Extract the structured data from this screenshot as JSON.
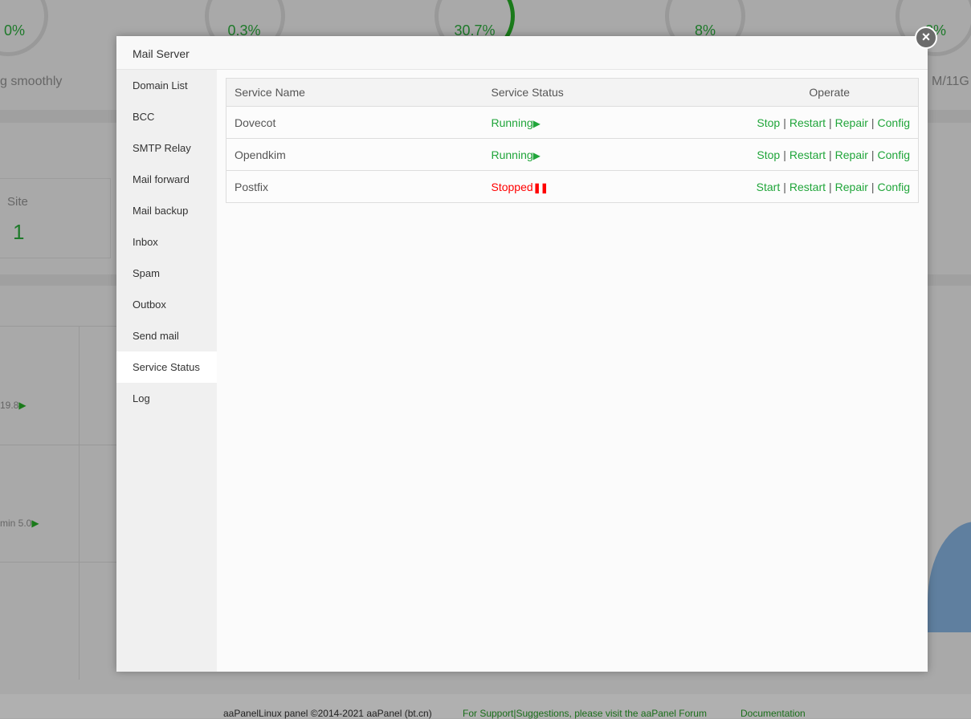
{
  "background": {
    "gauges": [
      {
        "value": "0%"
      },
      {
        "value": "0.3%"
      },
      {
        "value": "30.7%"
      },
      {
        "value": "8%"
      },
      {
        "value": "3%"
      }
    ],
    "gauge_sub_left": "g smoothly",
    "gauge_sub_right": "M/11G",
    "site_label": "Site",
    "site_value": "1",
    "app1": "19.8",
    "app2": "min 5.0"
  },
  "modal": {
    "title": "Mail Server",
    "close_icon": "close-icon",
    "sidebar": [
      {
        "label": "Domain List"
      },
      {
        "label": "BCC"
      },
      {
        "label": "SMTP Relay"
      },
      {
        "label": "Mail forward"
      },
      {
        "label": "Mail backup"
      },
      {
        "label": "Inbox"
      },
      {
        "label": "Spam"
      },
      {
        "label": "Outbox"
      },
      {
        "label": "Send mail"
      },
      {
        "label": "Service Status",
        "active": true
      },
      {
        "label": "Log"
      }
    ],
    "table": {
      "headers": [
        "Service Name",
        "Service Status",
        "Operate"
      ],
      "rows": [
        {
          "name": "Dovecot",
          "status": "Running",
          "status_icon": "play-icon",
          "status_color": "#20a53a",
          "ops": [
            "Stop",
            "Restart",
            "Repair",
            "Config"
          ]
        },
        {
          "name": "Opendkim",
          "status": "Running",
          "status_icon": "play-icon",
          "status_color": "#20a53a",
          "ops": [
            "Stop",
            "Restart",
            "Repair",
            "Config"
          ]
        },
        {
          "name": "Postfix",
          "status": "Stopped",
          "status_icon": "pause-icon",
          "status_color": "#ff0000",
          "ops": [
            "Start",
            "Restart",
            "Repair",
            "Config"
          ]
        }
      ]
    }
  },
  "footer": {
    "copyright": "aaPanelLinux panel ©2014-2021 aaPanel (bt.cn)",
    "support": "For Support|Suggestions, please visit the aaPanel Forum",
    "docs": "Documentation"
  }
}
